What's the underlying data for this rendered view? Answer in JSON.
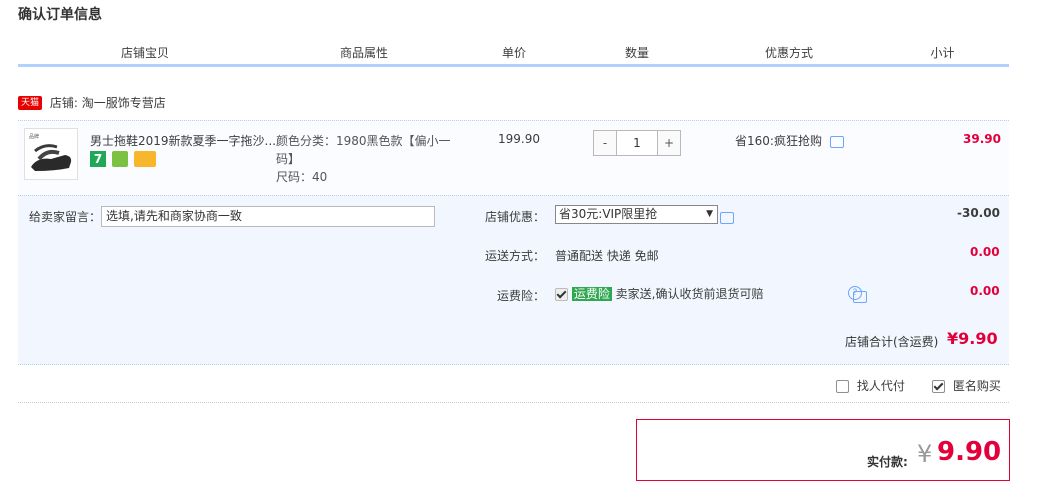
{
  "section_title": "确认订单信息",
  "columns": {
    "item": "店铺宝贝",
    "attrs": "商品属性",
    "price": "单价",
    "qty": "数量",
    "discount": "优惠方式",
    "subtotal": "小计"
  },
  "shop": {
    "badge": "天猫",
    "name": "店铺: 淘一服饰专营店"
  },
  "item": {
    "title": "男士拖鞋2019新款夏季一字拖沙...",
    "attr_line1": "颜色分类：1980黑色款【偏小一",
    "attr_line2": "码】",
    "attr_size": "尺码：40",
    "price": "199.90",
    "qty": "1",
    "qty_minus": "-",
    "qty_plus": "+",
    "discount": "省160:疯狂抢购",
    "subtotal": "39.90",
    "badge_7": "7"
  },
  "message": {
    "label": "给卖家留言：",
    "placeholder": "选填,请先和商家协商一致"
  },
  "shop_discount": {
    "label": "店铺优惠：",
    "selected": "省30元:VIP限里抢",
    "amount": "-30.00"
  },
  "shipping": {
    "label": "运送方式：",
    "value": "普通配送 快递 免邮",
    "amount": "0.00"
  },
  "insurance": {
    "label": "运费险：",
    "tag": "运费险",
    "desc": "卖家送,确认收货前退货可赔",
    "amount": "0.00"
  },
  "shop_total": {
    "label": "店铺合计(含运费)",
    "amount": "¥9.90"
  },
  "options": {
    "proxy_pay": "找人代付",
    "anonymous": "匿名购买",
    "proxy_checked": false,
    "anonymous_checked": true
  },
  "payment": {
    "label": "实付款:",
    "currency": "¥",
    "amount": "9.90"
  }
}
